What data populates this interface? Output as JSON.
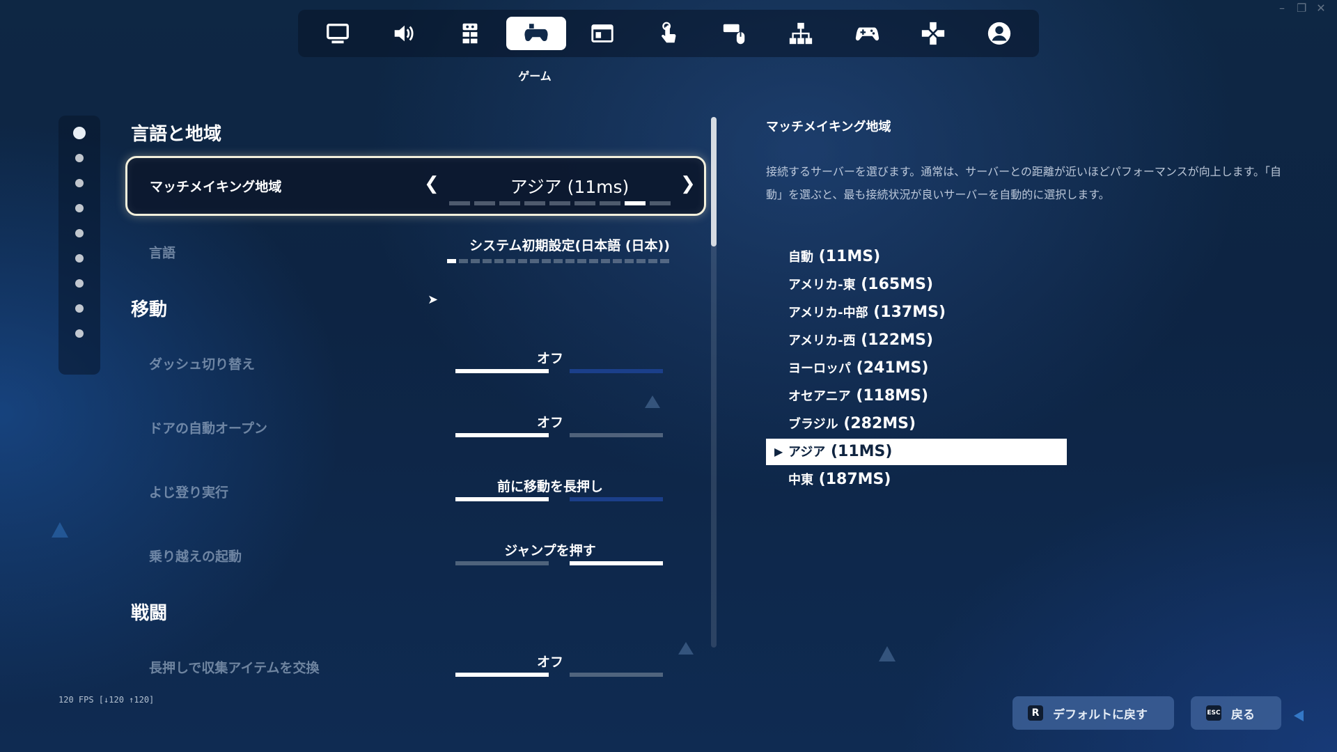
{
  "nav": {
    "tabs": [
      {
        "icon": "monitor-icon"
      },
      {
        "icon": "speaker-icon"
      },
      {
        "icon": "controller-layout-icon"
      },
      {
        "icon": "gamepad-icon"
      },
      {
        "icon": "hud-icon"
      },
      {
        "icon": "touch-icon"
      },
      {
        "icon": "keyboard-mouse-icon"
      },
      {
        "icon": "network-icon"
      },
      {
        "icon": "controller-icon"
      },
      {
        "icon": "dpad-icon"
      },
      {
        "icon": "account-icon"
      }
    ],
    "active_index": 3,
    "active_label": "ゲーム"
  },
  "sections": {
    "language_region": "言語と地域",
    "movement": "移動",
    "combat": "戦闘"
  },
  "settings": {
    "matchmaking": {
      "label": "マッチメイキング地域",
      "value": "アジア (11ms)",
      "segments": 9,
      "selected_segment": 8
    },
    "language": {
      "label": "言語",
      "value": "システム初期設定(日本語 (日本))",
      "segments": 19,
      "selected_segment": 1
    },
    "dash_toggle": {
      "label": "ダッシュ切り替え",
      "value": "オフ"
    },
    "auto_open_doors": {
      "label": "ドアの自動オープン",
      "value": "オフ"
    },
    "climb": {
      "label": "よじ登り実行",
      "value": "前に移動を長押し"
    },
    "mantle": {
      "label": "乗り越えの起動",
      "value": "ジャンプを押す"
    },
    "hold_swap": {
      "label": "長押しで収集アイテムを交換",
      "value": "オフ"
    }
  },
  "detail": {
    "title": "マッチメイキング地域",
    "description": "接続するサーバーを選びます。通常は、サーバーとの距離が近いほどパフォーマンスが向上します。「自動」を選ぶと、最も接続状況が良いサーバーを自動的に選択します。",
    "options": [
      {
        "name": "自動",
        "ping": "(11MS)"
      },
      {
        "name": "アメリカ-東",
        "ping": "(165MS)"
      },
      {
        "name": "アメリカ-中部",
        "ping": "(137MS)"
      },
      {
        "name": "アメリカ-西",
        "ping": "(122MS)"
      },
      {
        "name": "ヨーロッパ",
        "ping": "(241MS)"
      },
      {
        "name": "オセアニア",
        "ping": "(118MS)"
      },
      {
        "name": "ブラジル",
        "ping": "(282MS)"
      },
      {
        "name": "アジア",
        "ping": "(11MS)"
      },
      {
        "name": "中東",
        "ping": "(187MS)"
      }
    ],
    "selected_index": 7
  },
  "footer": {
    "fps": "120 FPS [↓120 ↑120]",
    "reset_key": "R",
    "reset_label": "デフォルトに戻す",
    "back_key": "ESC",
    "back_label": "戻る"
  },
  "colors": {
    "background": "#0e2744",
    "accent_blue": "#1b3f8a",
    "selected_border": "#f3f0dc"
  }
}
